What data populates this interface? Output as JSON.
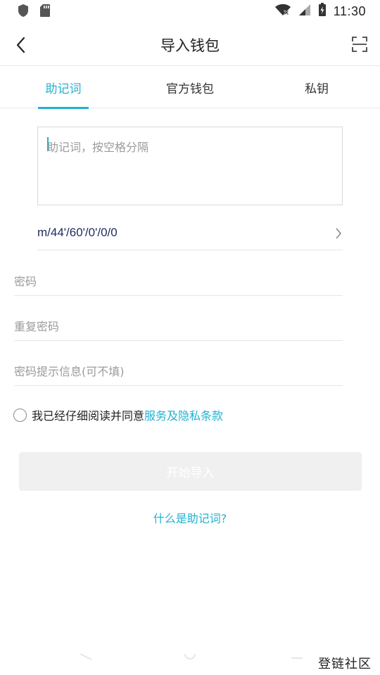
{
  "status_bar": {
    "time": "11:30",
    "icons": [
      "shield-icon",
      "sd-card-icon",
      "wifi-off-icon",
      "signal-icon",
      "battery-charging-icon"
    ]
  },
  "header": {
    "title": "导入钱包",
    "back_icon": "back-arrow-icon",
    "scan_icon": "scan-icon"
  },
  "tabs": [
    {
      "label": "助记词",
      "active": true
    },
    {
      "label": "官方钱包",
      "active": false
    },
    {
      "label": "私钥",
      "active": false
    }
  ],
  "mnemonic": {
    "placeholder": "助记词，按空格分隔",
    "value": ""
  },
  "path": {
    "value": "m/44'/60'/0'/0/0"
  },
  "fields": {
    "password": {
      "placeholder": "密码"
    },
    "repeat_password": {
      "placeholder": "重复密码"
    },
    "password_hint": {
      "placeholder": "密码提示信息(可不填)"
    }
  },
  "agreement": {
    "text": "我已经仔细阅读并同意",
    "link": "服务及隐私条款",
    "checked": false
  },
  "start_button": {
    "label": "开始导入"
  },
  "what_is_link": {
    "label": "什么是助记词?"
  },
  "watermark": {
    "text": "登链社区"
  },
  "colors": {
    "accent": "#20b2d2",
    "placeholder": "#9b9b9b",
    "path_text": "#1f2a5c",
    "button_disabled_bg": "#f0f0f0"
  }
}
